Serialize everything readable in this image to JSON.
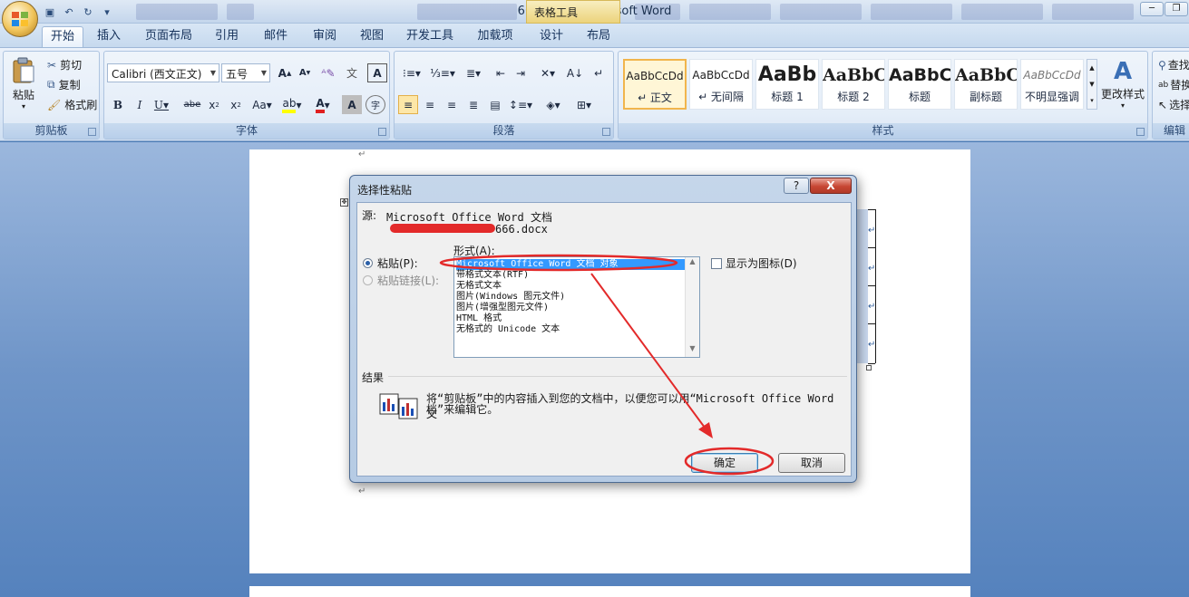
{
  "window": {
    "title": "666.docx - Microsoft Word",
    "context_tab": "表格工具",
    "controls": [
      "─",
      "❐"
    ]
  },
  "quick_access": [
    "save-icon",
    "undo-icon",
    "redo-icon",
    "customize-icon"
  ],
  "tabs": [
    "开始",
    "插入",
    "页面布局",
    "引用",
    "邮件",
    "审阅",
    "视图",
    "开发工具",
    "加载项",
    "设计",
    "布局"
  ],
  "ribbon": {
    "clipboard": {
      "label": "剪贴板",
      "paste": "粘贴",
      "cut": "剪切",
      "copy": "复制",
      "format_painter": "格式刷"
    },
    "font": {
      "label": "字体",
      "font_name": "Calibri (西文正文)",
      "font_size": "五号"
    },
    "paragraph": {
      "label": "段落"
    },
    "styles": {
      "label": "样式",
      "items": [
        {
          "sample": "AaBbCcDd",
          "name": "↵ 正文"
        },
        {
          "sample": "AaBbCcDd",
          "name": "↵ 无间隔"
        },
        {
          "sample": "AaBb",
          "name": "标题 1"
        },
        {
          "sample": "AaBbC",
          "name": "标题 2"
        },
        {
          "sample": "AaBbC",
          "name": "标题"
        },
        {
          "sample": "AaBbC",
          "name": "副标题"
        },
        {
          "sample": "AaBbCcDd",
          "name": "不明显强调"
        }
      ],
      "change_styles": "更改样式"
    },
    "editing": {
      "label": "编辑",
      "find": "查找",
      "replace": "替换",
      "select": "选择"
    }
  },
  "dialog": {
    "title": "选择性粘贴",
    "help": "?",
    "close": "X",
    "source_label": "源:",
    "source_value": "Microsoft Office Word 文档",
    "source_path": "666.docx",
    "as_label": "形式(A):",
    "paste_option": "粘贴(P):",
    "paste_link_option": "粘贴链接(L):",
    "formats": [
      "Microsoft Office Word 文档 对象",
      "带格式文本(RTF)",
      "无格式文本",
      "图片(Windows 图元文件)",
      "图片(增强型图元文件)",
      "HTML 格式",
      "无格式的 Unicode 文本"
    ],
    "display_as_icon": "显示为图标(D)",
    "result_label": "结果",
    "result_text_1": "将“剪贴板”中的内容插入到您的文档中，以便您可以用“Microsoft Office Word 文",
    "result_text_2": "档”来编辑它。",
    "ok": "确定",
    "cancel": "取消"
  },
  "annotation_color": "#e32a2a"
}
